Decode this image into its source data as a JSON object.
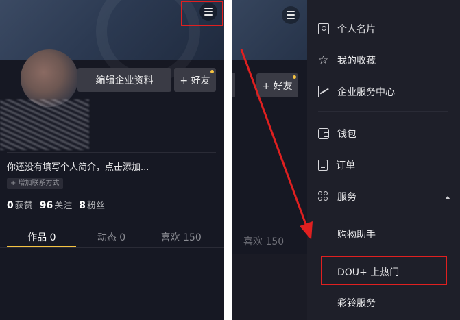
{
  "left_panel": {
    "edit_profile_label": "编辑企业资料",
    "add_friend_label": "+ 好友",
    "bio_prompt": "你还没有填写个人简介，点击添加...",
    "add_contact_label": "+ 增加联系方式",
    "stats": [
      {
        "value": "0",
        "label": "获赞"
      },
      {
        "value": "96",
        "label": "关注"
      },
      {
        "value": "8",
        "label": "粉丝"
      }
    ],
    "tabs": [
      {
        "label": "作品 0"
      },
      {
        "label": "动态 0"
      },
      {
        "label": "喜欢 150"
      }
    ]
  },
  "right_panel": {
    "add_friend_label": "+ 好友",
    "likes_tab_label": "喜欢 150",
    "drawer": {
      "items": [
        {
          "label": "个人名片",
          "icon": "card-icon"
        },
        {
          "label": "我的收藏",
          "icon": "star-icon"
        },
        {
          "label": "企业服务中心",
          "icon": "chart-icon"
        },
        {
          "label": "钱包",
          "icon": "wallet-icon"
        },
        {
          "label": "订单",
          "icon": "order-icon"
        },
        {
          "label": "服务",
          "icon": "grid-icon"
        }
      ],
      "sub_items": [
        {
          "label": "购物助手"
        },
        {
          "label": "DOU+ 上热门"
        },
        {
          "label": "彩铃服务"
        }
      ]
    }
  },
  "colors": {
    "background": "#161823",
    "drawer_bg": "#1e1f29",
    "accent": "#f5c342",
    "annotation_red": "#e02020"
  }
}
